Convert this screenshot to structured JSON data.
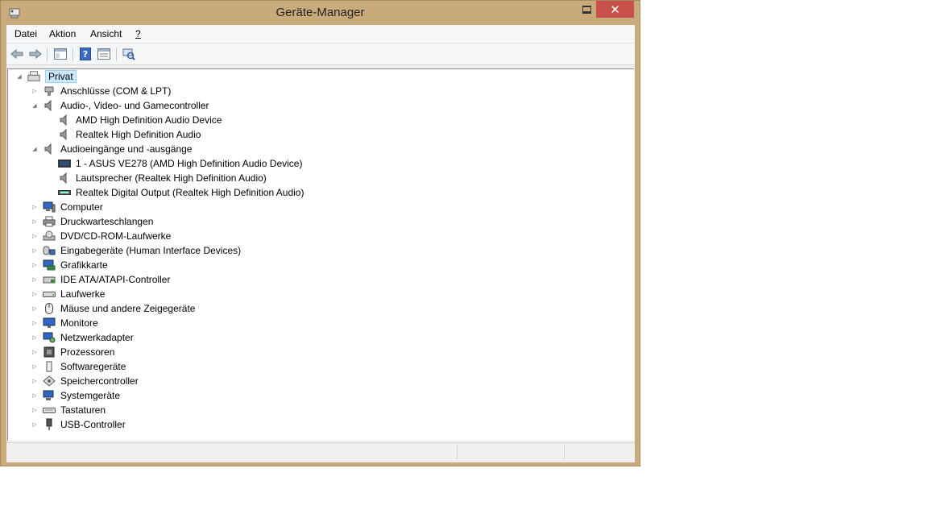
{
  "window": {
    "title": "Geräte-Manager"
  },
  "menu": [
    {
      "label": "Datei",
      "underline": "D",
      "rest": "atei"
    },
    {
      "label": "Aktion",
      "underline": "k",
      "pre": "A",
      "rest": "tion"
    },
    {
      "label": "Ansicht",
      "underline": "A",
      "rest": "nsicht"
    },
    {
      "label": "?",
      "underline": "?",
      "rest": ""
    }
  ],
  "toolbar": [
    "back-icon",
    "forward-icon",
    "show-hide-console-tree-icon",
    "help-icon",
    "properties-icon",
    "scan-hardware-icon"
  ],
  "tree": {
    "root": "Privat",
    "items": [
      {
        "label": "Anschlüsse (COM & LPT)",
        "icon": "ports-icon",
        "expanded": false
      },
      {
        "label": "Audio-, Video- und Gamecontroller",
        "icon": "speaker-icon",
        "expanded": true,
        "children": [
          {
            "label": "AMD High Definition Audio Device",
            "icon": "speaker-icon"
          },
          {
            "label": "Realtek High Definition Audio",
            "icon": "speaker-icon"
          }
        ]
      },
      {
        "label": "Audioeingänge und -ausgänge",
        "icon": "speaker-icon",
        "expanded": true,
        "children": [
          {
            "label": "1 - ASUS VE278 (AMD High Definition Audio Device)",
            "icon": "monitor-audio-icon"
          },
          {
            "label": "Lautsprecher (Realtek High Definition Audio)",
            "icon": "speaker-icon"
          },
          {
            "label": "Realtek Digital Output (Realtek High Definition Audio)",
            "icon": "digital-output-icon"
          }
        ]
      },
      {
        "label": "Computer",
        "icon": "computer-icon",
        "expanded": false
      },
      {
        "label": "Druckwarteschlangen",
        "icon": "printer-icon",
        "expanded": false
      },
      {
        "label": "DVD/CD-ROM-Laufwerke",
        "icon": "dvd-drive-icon",
        "expanded": false
      },
      {
        "label": "Eingabegeräte (Human Interface Devices)",
        "icon": "hid-icon",
        "expanded": false
      },
      {
        "label": "Grafikkarte",
        "icon": "display-adapter-icon",
        "expanded": false
      },
      {
        "label": "IDE ATA/ATAPI-Controller",
        "icon": "ide-controller-icon",
        "expanded": false
      },
      {
        "label": "Laufwerke",
        "icon": "disk-drive-icon",
        "expanded": false
      },
      {
        "label": "Mäuse und andere Zeigegeräte",
        "icon": "mouse-icon",
        "expanded": false
      },
      {
        "label": "Monitore",
        "icon": "monitor-icon",
        "expanded": false
      },
      {
        "label": "Netzwerkadapter",
        "icon": "network-adapter-icon",
        "expanded": false
      },
      {
        "label": "Prozessoren",
        "icon": "processor-icon",
        "expanded": false
      },
      {
        "label": "Softwaregeräte",
        "icon": "software-device-icon",
        "expanded": false
      },
      {
        "label": "Speichercontroller",
        "icon": "storage-controller-icon",
        "expanded": false
      },
      {
        "label": "Systemgeräte",
        "icon": "system-device-icon",
        "expanded": false
      },
      {
        "label": "Tastaturen",
        "icon": "keyboard-icon",
        "expanded": false
      },
      {
        "label": "USB-Controller",
        "icon": "usb-icon",
        "expanded": false
      }
    ]
  },
  "colors": {
    "frame": "#c9ab7b",
    "close": "#c7504a",
    "selection": "#cce8ff"
  }
}
